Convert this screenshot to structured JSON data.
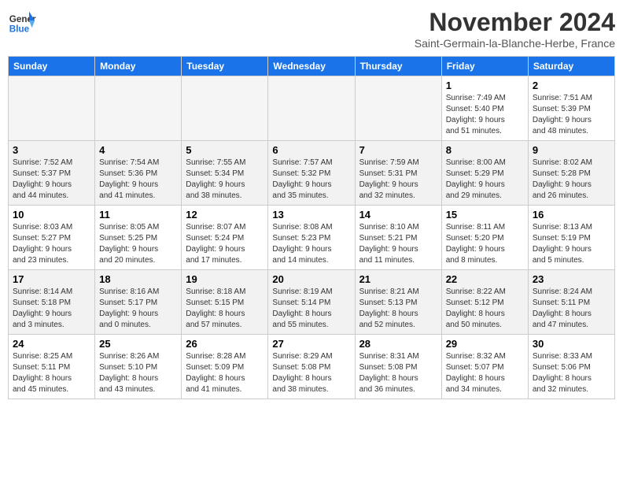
{
  "logo": {
    "line1": "General",
    "line2": "Blue"
  },
  "title": "November 2024",
  "subtitle": "Saint-Germain-la-Blanche-Herbe, France",
  "weekdays": [
    "Sunday",
    "Monday",
    "Tuesday",
    "Wednesday",
    "Thursday",
    "Friday",
    "Saturday"
  ],
  "weeks": [
    [
      {
        "day": "",
        "detail": ""
      },
      {
        "day": "",
        "detail": ""
      },
      {
        "day": "",
        "detail": ""
      },
      {
        "day": "",
        "detail": ""
      },
      {
        "day": "",
        "detail": ""
      },
      {
        "day": "1",
        "detail": "Sunrise: 7:49 AM\nSunset: 5:40 PM\nDaylight: 9 hours\nand 51 minutes."
      },
      {
        "day": "2",
        "detail": "Sunrise: 7:51 AM\nSunset: 5:39 PM\nDaylight: 9 hours\nand 48 minutes."
      }
    ],
    [
      {
        "day": "3",
        "detail": "Sunrise: 7:52 AM\nSunset: 5:37 PM\nDaylight: 9 hours\nand 44 minutes."
      },
      {
        "day": "4",
        "detail": "Sunrise: 7:54 AM\nSunset: 5:36 PM\nDaylight: 9 hours\nand 41 minutes."
      },
      {
        "day": "5",
        "detail": "Sunrise: 7:55 AM\nSunset: 5:34 PM\nDaylight: 9 hours\nand 38 minutes."
      },
      {
        "day": "6",
        "detail": "Sunrise: 7:57 AM\nSunset: 5:32 PM\nDaylight: 9 hours\nand 35 minutes."
      },
      {
        "day": "7",
        "detail": "Sunrise: 7:59 AM\nSunset: 5:31 PM\nDaylight: 9 hours\nand 32 minutes."
      },
      {
        "day": "8",
        "detail": "Sunrise: 8:00 AM\nSunset: 5:29 PM\nDaylight: 9 hours\nand 29 minutes."
      },
      {
        "day": "9",
        "detail": "Sunrise: 8:02 AM\nSunset: 5:28 PM\nDaylight: 9 hours\nand 26 minutes."
      }
    ],
    [
      {
        "day": "10",
        "detail": "Sunrise: 8:03 AM\nSunset: 5:27 PM\nDaylight: 9 hours\nand 23 minutes."
      },
      {
        "day": "11",
        "detail": "Sunrise: 8:05 AM\nSunset: 5:25 PM\nDaylight: 9 hours\nand 20 minutes."
      },
      {
        "day": "12",
        "detail": "Sunrise: 8:07 AM\nSunset: 5:24 PM\nDaylight: 9 hours\nand 17 minutes."
      },
      {
        "day": "13",
        "detail": "Sunrise: 8:08 AM\nSunset: 5:23 PM\nDaylight: 9 hours\nand 14 minutes."
      },
      {
        "day": "14",
        "detail": "Sunrise: 8:10 AM\nSunset: 5:21 PM\nDaylight: 9 hours\nand 11 minutes."
      },
      {
        "day": "15",
        "detail": "Sunrise: 8:11 AM\nSunset: 5:20 PM\nDaylight: 9 hours\nand 8 minutes."
      },
      {
        "day": "16",
        "detail": "Sunrise: 8:13 AM\nSunset: 5:19 PM\nDaylight: 9 hours\nand 5 minutes."
      }
    ],
    [
      {
        "day": "17",
        "detail": "Sunrise: 8:14 AM\nSunset: 5:18 PM\nDaylight: 9 hours\nand 3 minutes."
      },
      {
        "day": "18",
        "detail": "Sunrise: 8:16 AM\nSunset: 5:17 PM\nDaylight: 9 hours\nand 0 minutes."
      },
      {
        "day": "19",
        "detail": "Sunrise: 8:18 AM\nSunset: 5:15 PM\nDaylight: 8 hours\nand 57 minutes."
      },
      {
        "day": "20",
        "detail": "Sunrise: 8:19 AM\nSunset: 5:14 PM\nDaylight: 8 hours\nand 55 minutes."
      },
      {
        "day": "21",
        "detail": "Sunrise: 8:21 AM\nSunset: 5:13 PM\nDaylight: 8 hours\nand 52 minutes."
      },
      {
        "day": "22",
        "detail": "Sunrise: 8:22 AM\nSunset: 5:12 PM\nDaylight: 8 hours\nand 50 minutes."
      },
      {
        "day": "23",
        "detail": "Sunrise: 8:24 AM\nSunset: 5:11 PM\nDaylight: 8 hours\nand 47 minutes."
      }
    ],
    [
      {
        "day": "24",
        "detail": "Sunrise: 8:25 AM\nSunset: 5:11 PM\nDaylight: 8 hours\nand 45 minutes."
      },
      {
        "day": "25",
        "detail": "Sunrise: 8:26 AM\nSunset: 5:10 PM\nDaylight: 8 hours\nand 43 minutes."
      },
      {
        "day": "26",
        "detail": "Sunrise: 8:28 AM\nSunset: 5:09 PM\nDaylight: 8 hours\nand 41 minutes."
      },
      {
        "day": "27",
        "detail": "Sunrise: 8:29 AM\nSunset: 5:08 PM\nDaylight: 8 hours\nand 38 minutes."
      },
      {
        "day": "28",
        "detail": "Sunrise: 8:31 AM\nSunset: 5:08 PM\nDaylight: 8 hours\nand 36 minutes."
      },
      {
        "day": "29",
        "detail": "Sunrise: 8:32 AM\nSunset: 5:07 PM\nDaylight: 8 hours\nand 34 minutes."
      },
      {
        "day": "30",
        "detail": "Sunrise: 8:33 AM\nSunset: 5:06 PM\nDaylight: 8 hours\nand 32 minutes."
      }
    ]
  ]
}
